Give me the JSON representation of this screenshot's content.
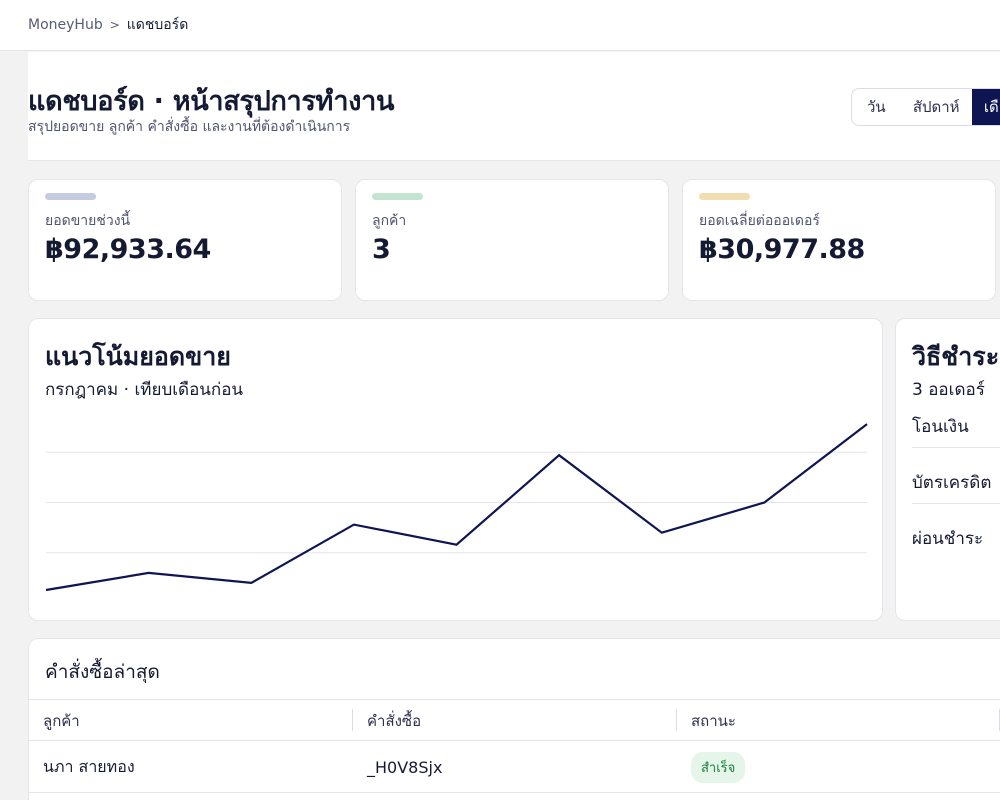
{
  "breadcrumb": {
    "root": "MoneyHub",
    "separator": ">",
    "current": "แดชบอร์ด"
  },
  "header": {
    "title": "แดชบอร์ด · หน้าสรุปการทำงาน",
    "subtitle": "สรุปยอดขาย ลูกค้า คำสั่งซื้อ และงานที่ต้องดำเนินการ"
  },
  "range_tabs": [
    {
      "label": "วัน",
      "active": false
    },
    {
      "label": "สัปดาห์",
      "active": false
    },
    {
      "label": "เดือน",
      "active": true
    }
  ],
  "kpis": [
    {
      "label": "ยอดขายช่วงนี้",
      "value": "฿92,933.64",
      "accent": "#c5cbe1"
    },
    {
      "label": "ลูกค้า",
      "value": "3",
      "accent": "#c4e4d2"
    },
    {
      "label": "ยอดเฉลี่ยต่อออเดอร์",
      "value": "฿30,977.88",
      "accent": "#f1ddb0"
    }
  ],
  "trend": {
    "title": "แนวโน้มยอดขาย",
    "subtitle": "กรกฎาคม · เทียบเดือนก่อน",
    "line_color": "#0e1552"
  },
  "chart_data": {
    "type": "line",
    "x": [
      1,
      2,
      3,
      4,
      5,
      6,
      7,
      8,
      9
    ],
    "series": [
      {
        "values": [
          3,
          20,
          10,
          68,
          48,
          137,
          60,
          90,
          168
        ]
      }
    ],
    "ylim": [
      0,
      180
    ],
    "grid": true,
    "gridlines_y": [
      40,
      90,
      140
    ]
  },
  "payment": {
    "title": "วิธีชำระเงิน",
    "subtitle": "3 ออเดอร์",
    "methods": [
      "โอนเงิน",
      "บัตรเครดิต",
      "ผ่อนชำระ"
    ]
  },
  "orders": {
    "title": "คำสั่งซื้อล่าสุด",
    "columns": [
      "ลูกค้า",
      "คำสั่งซื้อ",
      "สถานะ"
    ],
    "rows": [
      {
        "customer": "นภา สายทอง",
        "order": "_H0V8Sjx",
        "status": "สำเร็จ"
      }
    ]
  },
  "colors": {
    "primary": "#0e1552",
    "success_bg": "#e5f5ea",
    "success_text": "#18803c"
  }
}
